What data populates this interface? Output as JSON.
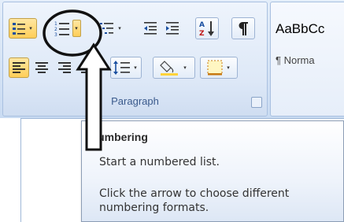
{
  "ribbon": {
    "paragraph_group": {
      "label": "Paragraph",
      "row1": [
        "bullets-icon",
        "numbering-icon",
        "multilevel-list-icon",
        "decrease-indent-icon",
        "increase-indent-icon",
        "sort-icon",
        "pilcrow-icon"
      ],
      "row2": [
        "align-left-icon",
        "center-icon",
        "align-right-icon",
        "justify-icon",
        "line-spacing-icon",
        "shading-icon",
        "borders-icon"
      ]
    },
    "styles_group": {
      "sample": "AaBbCc",
      "style_name": "¶ Norma"
    }
  },
  "tooltip": {
    "title": "Numbering",
    "line1": "Start a numbered list.",
    "line2": "Click the arrow to choose different",
    "line3": "numbering formats."
  },
  "colors": {
    "ribbon": "#d6e4f5",
    "highlight": "#ffce58",
    "group_label": "#3a5a8c"
  }
}
